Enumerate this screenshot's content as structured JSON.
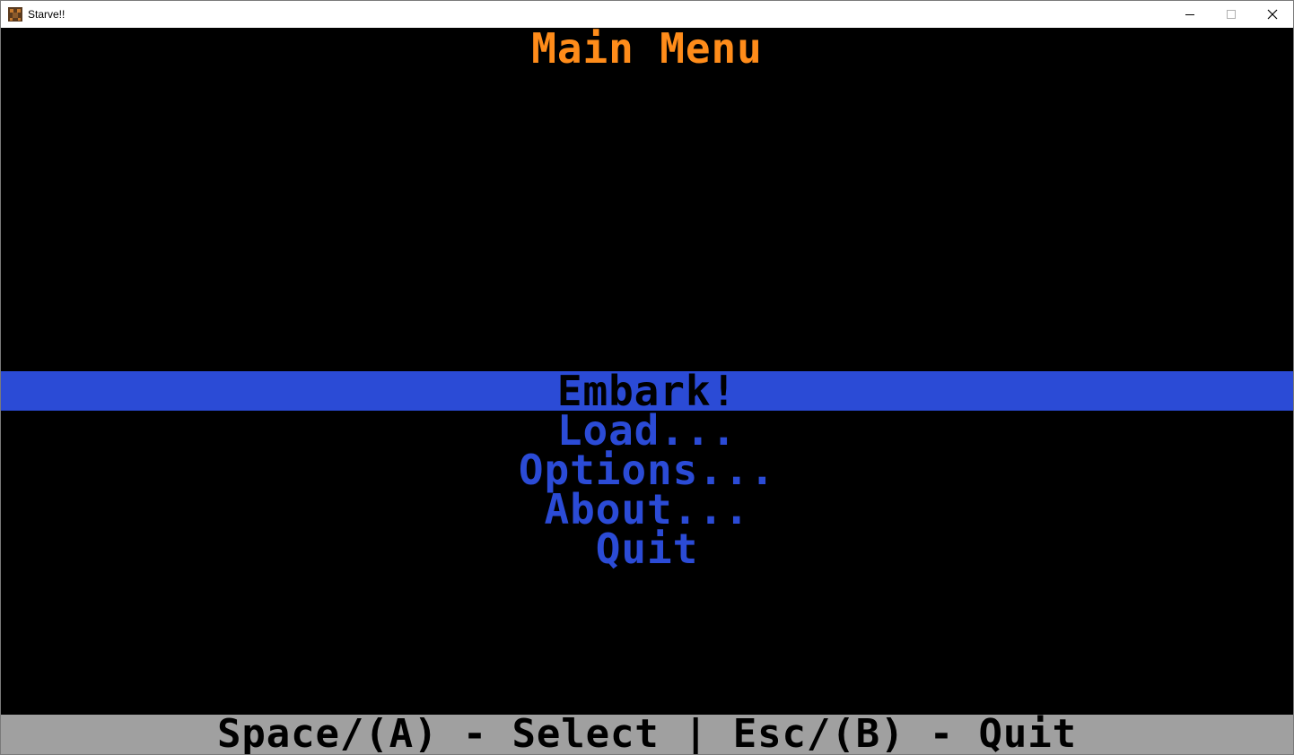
{
  "window": {
    "title": "Starve!!",
    "app_icon": "starve-app-icon",
    "controls": [
      "minimize-icon",
      "maximize-icon",
      "close-icon"
    ]
  },
  "game": {
    "heading": "Main Menu",
    "menu": {
      "items": [
        {
          "label": "Embark!",
          "selected": true
        },
        {
          "label": "Load...",
          "selected": false
        },
        {
          "label": "Options...",
          "selected": false
        },
        {
          "label": "About...",
          "selected": false
        },
        {
          "label": "Quit",
          "selected": false
        }
      ]
    },
    "status_bar": "Space/(A) - Select | Esc/(B) - Quit"
  },
  "colors": {
    "heading": "#ff8c1a",
    "menu_text": "#2b4bd6",
    "selection_bar": "#2b4bd6",
    "status_bar_bg": "#a0a0a0",
    "background": "#000000"
  }
}
